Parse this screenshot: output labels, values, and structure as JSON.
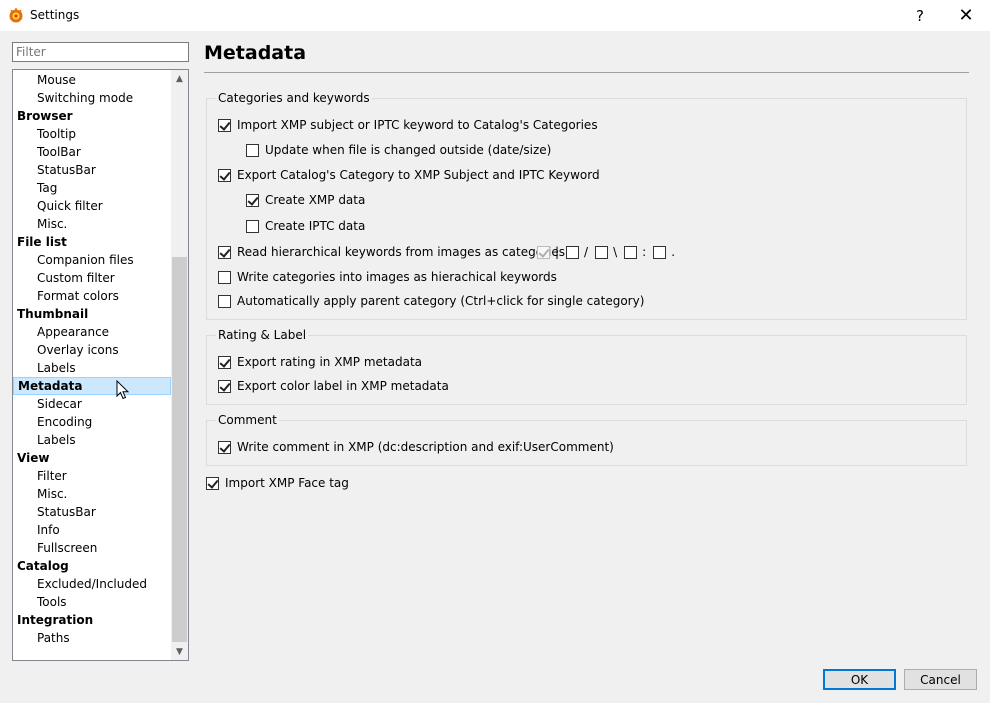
{
  "window": {
    "title": "Settings",
    "help": "?",
    "close": "✕"
  },
  "filter": {
    "placeholder": "Filter"
  },
  "tree": [
    {
      "label": "Mouse",
      "level": 1
    },
    {
      "label": "Switching mode",
      "level": 1
    },
    {
      "label": "Browser",
      "level": 0
    },
    {
      "label": "Tooltip",
      "level": 1
    },
    {
      "label": "ToolBar",
      "level": 1
    },
    {
      "label": "StatusBar",
      "level": 1
    },
    {
      "label": "Tag",
      "level": 1
    },
    {
      "label": "Quick filter",
      "level": 1
    },
    {
      "label": "Misc.",
      "level": 1
    },
    {
      "label": "File list",
      "level": 0
    },
    {
      "label": "Companion files",
      "level": 1
    },
    {
      "label": "Custom filter",
      "level": 1
    },
    {
      "label": "Format colors",
      "level": 1
    },
    {
      "label": "Thumbnail",
      "level": 0
    },
    {
      "label": "Appearance",
      "level": 1
    },
    {
      "label": "Overlay icons",
      "level": 1
    },
    {
      "label": "Labels",
      "level": 1
    },
    {
      "label": "Metadata",
      "level": 0,
      "selected": true
    },
    {
      "label": "Sidecar",
      "level": 1
    },
    {
      "label": "Encoding",
      "level": 1
    },
    {
      "label": "Labels",
      "level": 1
    },
    {
      "label": "View",
      "level": 0
    },
    {
      "label": "Filter",
      "level": 1
    },
    {
      "label": "Misc.",
      "level": 1
    },
    {
      "label": "StatusBar",
      "level": 1
    },
    {
      "label": "Info",
      "level": 1
    },
    {
      "label": "Fullscreen",
      "level": 1
    },
    {
      "label": "Catalog",
      "level": 0
    },
    {
      "label": "Excluded/Included",
      "level": 1
    },
    {
      "label": "Tools",
      "level": 1
    },
    {
      "label": "Integration",
      "level": 0
    },
    {
      "label": "Paths",
      "level": 1
    }
  ],
  "page": {
    "title": "Metadata"
  },
  "categories": {
    "label": "Categories and keywords",
    "import_xmp": {
      "label": "Import XMP subject or IPTC keyword to Catalog's Categories",
      "checked": true
    },
    "update_outside": {
      "label": "Update when file is changed outside (date/size)",
      "checked": false
    },
    "export_category": {
      "label": "Export Catalog's Category to XMP Subject and IPTC Keyword",
      "checked": true
    },
    "create_xmp": {
      "label": "Create XMP data",
      "checked": true
    },
    "create_iptc": {
      "label": "Create IPTC data",
      "checked": false
    },
    "read_hier": {
      "label": "Read hierarchical keywords from images as categories",
      "checked": true
    },
    "separators": [
      "|",
      "/",
      "\\",
      ":",
      "."
    ],
    "write_hier": {
      "label": "Write categories into images as hierachical keywords",
      "checked": false
    },
    "auto_parent": {
      "label": "Automatically apply parent category (Ctrl+click for single category)",
      "checked": false
    }
  },
  "rating": {
    "label": "Rating & Label",
    "export_rating": {
      "label": "Export rating in XMP metadata",
      "checked": true
    },
    "export_color": {
      "label": "Export color label in XMP metadata",
      "checked": true
    }
  },
  "comment": {
    "label": "Comment",
    "write_comment": {
      "label": "Write comment in XMP (dc:description and exif:UserComment)",
      "checked": true
    }
  },
  "face": {
    "label": "Import XMP Face tag",
    "checked": true
  },
  "buttons": {
    "ok": "OK",
    "cancel": "Cancel"
  },
  "colors": {
    "selection": "#cce8ff",
    "accent": "#0078d7"
  }
}
